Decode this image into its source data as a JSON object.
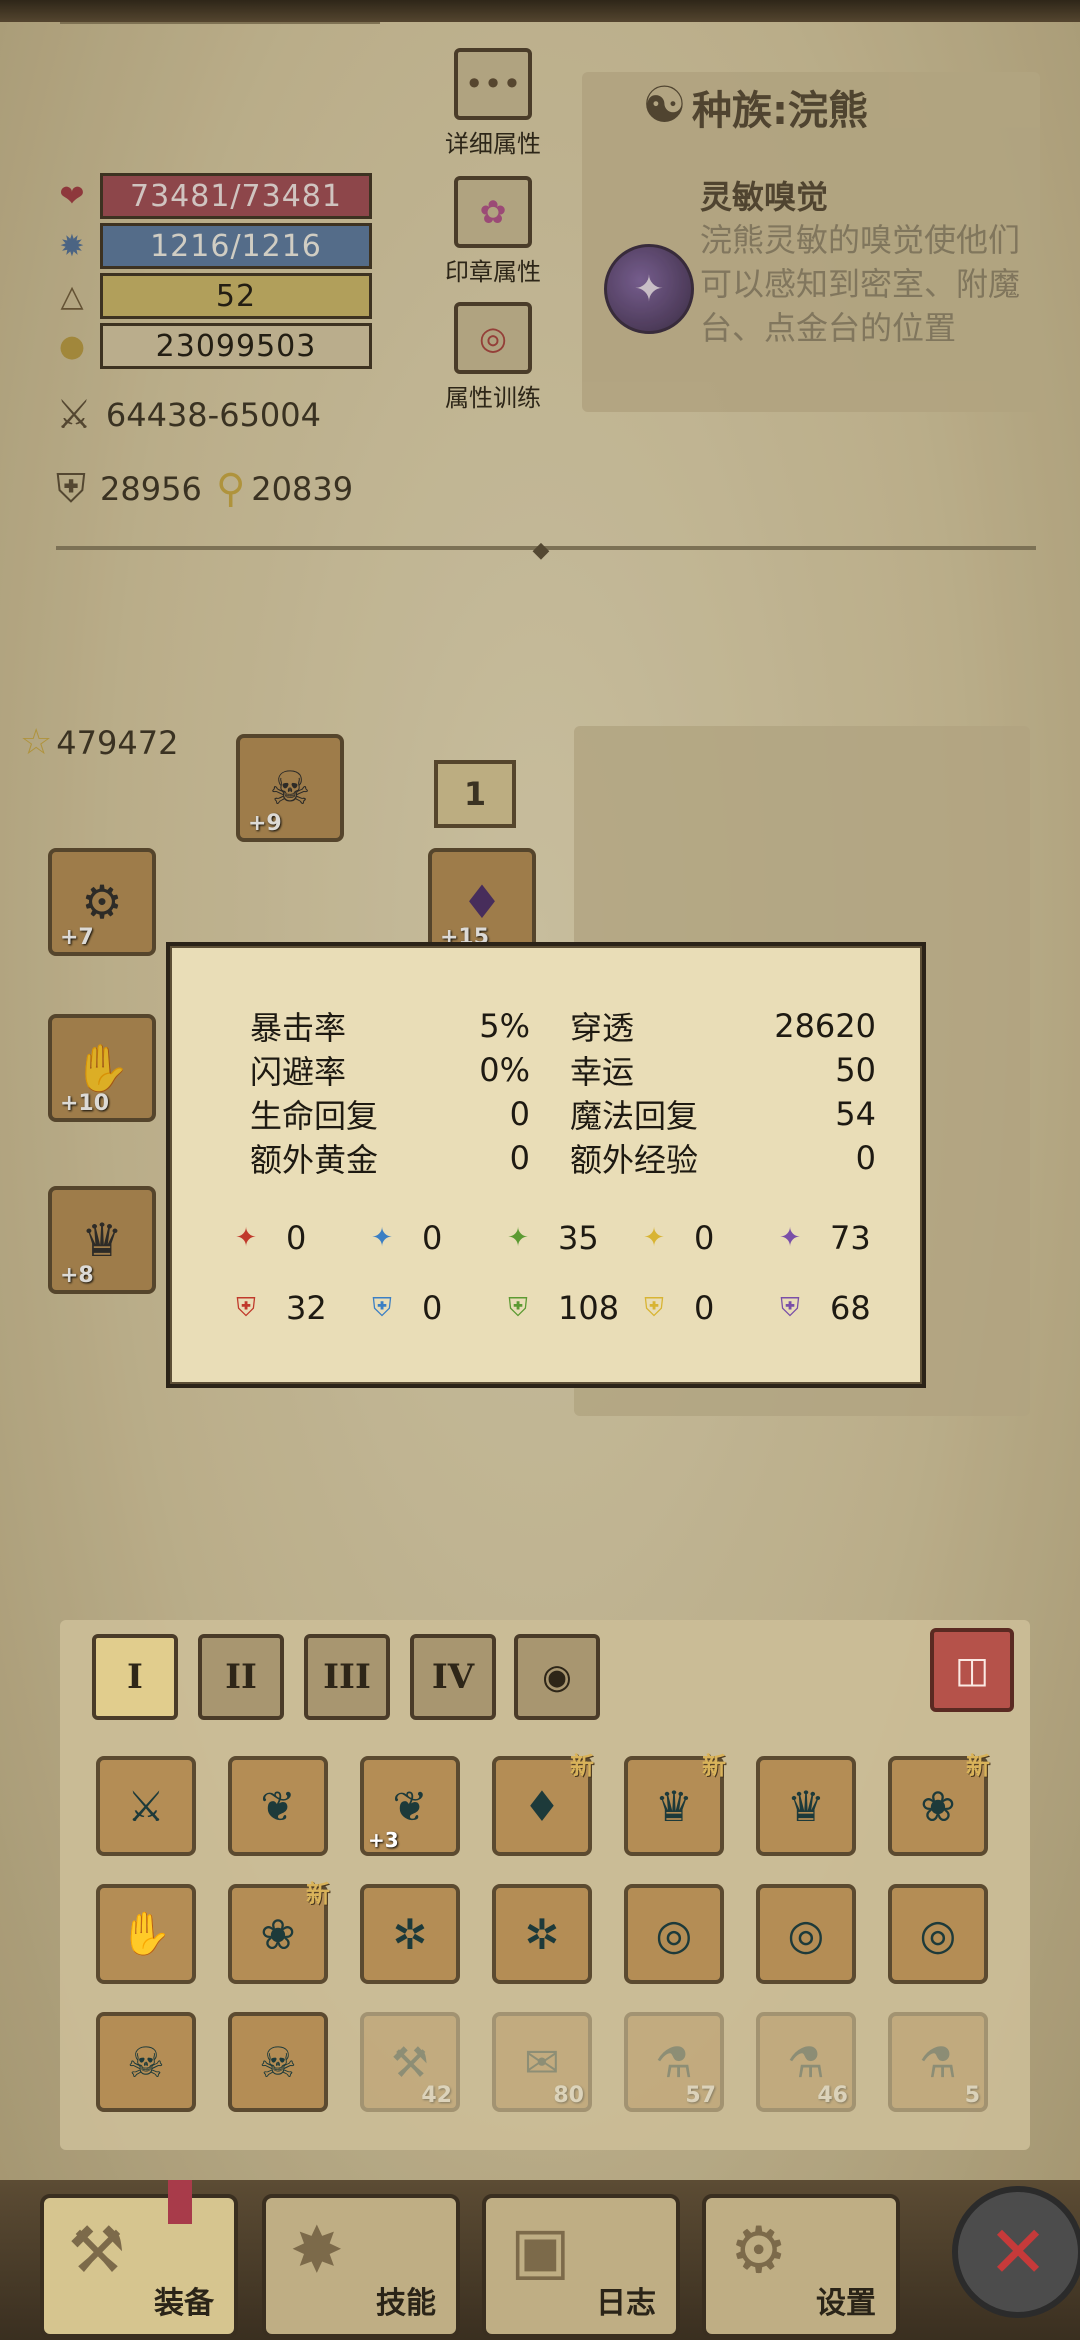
{
  "stats": {
    "hp": "73481/73481",
    "mp": "1216/1216",
    "level": "52",
    "gold": "23099503",
    "attack": "64438-65004",
    "defense": "28956",
    "magic_defense": "20839"
  },
  "side_buttons": [
    {
      "label": "详细属性",
      "icon": "dots-icon"
    },
    {
      "label": "印章属性",
      "icon": "flower-icon"
    },
    {
      "label": "属性训练",
      "icon": "target-icon"
    }
  ],
  "race": {
    "title": "种族:浣熊",
    "skill_name": "灵敏嗅觉",
    "skill_desc": "浣熊灵敏的嗅觉使他们可以感知到密室、附魔台、点金台的位置"
  },
  "score": "479472",
  "level_box": "1",
  "equip_slots": [
    {
      "icon": "helmet-icon",
      "plus": "+9"
    },
    {
      "icon": "shield-icon",
      "plus": "+7"
    },
    {
      "icon": "armor-icon",
      "plus": "+15"
    },
    {
      "icon": "gauntlet-icon",
      "plus": "+10"
    },
    {
      "icon": "boots-icon",
      "plus": "+8"
    }
  ],
  "tooltip": {
    "rows": [
      {
        "k1": "暴击率",
        "v1": "5%",
        "k2": "穿透",
        "v2": "28620"
      },
      {
        "k1": "闪避率",
        "v1": "0%",
        "k2": "幸运",
        "v2": "50"
      },
      {
        "k1": "生命回复",
        "v1": "0",
        "k2": "魔法回复",
        "v2": "54"
      },
      {
        "k1": "额外黄金",
        "v1": "0",
        "k2": "额外经验",
        "v2": "0"
      }
    ],
    "attack_res": [
      "0",
      "0",
      "35",
      "0",
      "73"
    ],
    "defense_res": [
      "32",
      "0",
      "108",
      "0",
      "68"
    ],
    "res_colors": [
      "#c0392b",
      "#3b7fc4",
      "#5c9a32",
      "#d8b433",
      "#7a4fa8"
    ]
  },
  "inventory": {
    "tabs": [
      "I",
      "II",
      "III",
      "IV"
    ],
    "new_label": "新",
    "items": [
      {
        "icon": "sword-icon",
        "new": false,
        "plus": "",
        "count": ""
      },
      {
        "icon": "wing-armor-icon",
        "new": false,
        "plus": "",
        "count": ""
      },
      {
        "icon": "wing-armor-icon",
        "new": false,
        "plus": "+3",
        "count": ""
      },
      {
        "icon": "gem-armor-icon",
        "new": true,
        "plus": "",
        "count": ""
      },
      {
        "icon": "boots-icon",
        "new": true,
        "plus": "",
        "count": ""
      },
      {
        "icon": "boots-icon",
        "new": false,
        "plus": "",
        "count": ""
      },
      {
        "icon": "claw-icon",
        "new": true,
        "plus": "",
        "count": ""
      },
      {
        "icon": "gauntlet-icon",
        "new": false,
        "plus": "",
        "count": ""
      },
      {
        "icon": "claw-icon",
        "new": true,
        "plus": "",
        "count": ""
      },
      {
        "icon": "bat-icon",
        "new": false,
        "plus": "",
        "count": ""
      },
      {
        "icon": "bat-icon",
        "new": false,
        "plus": "",
        "count": ""
      },
      {
        "icon": "ring-icon",
        "new": false,
        "plus": "",
        "count": ""
      },
      {
        "icon": "ring-icon",
        "new": false,
        "plus": "",
        "count": ""
      },
      {
        "icon": "ring-icon",
        "new": false,
        "plus": "",
        "count": ""
      },
      {
        "icon": "demon-icon",
        "new": false,
        "plus": "",
        "count": ""
      },
      {
        "icon": "demon-icon",
        "new": false,
        "plus": "",
        "count": ""
      },
      {
        "icon": "pickaxe-icon",
        "new": false,
        "plus": "",
        "count": "42",
        "faded": true
      },
      {
        "icon": "scroll-icon",
        "new": false,
        "plus": "",
        "count": "80",
        "faded": true
      },
      {
        "icon": "potion-icon",
        "new": false,
        "plus": "",
        "count": "57",
        "faded": true
      },
      {
        "icon": "potion-icon",
        "new": false,
        "plus": "",
        "count": "46",
        "faded": true
      },
      {
        "icon": "potion-icon",
        "new": false,
        "plus": "",
        "count": "5",
        "faded": true
      }
    ]
  },
  "nav": [
    {
      "label": "装备",
      "icon": "axe-icon"
    },
    {
      "label": "技能",
      "icon": "skill-icon"
    },
    {
      "label": "日志",
      "icon": "book-icon"
    },
    {
      "label": "设置",
      "icon": "gear-icon"
    }
  ]
}
